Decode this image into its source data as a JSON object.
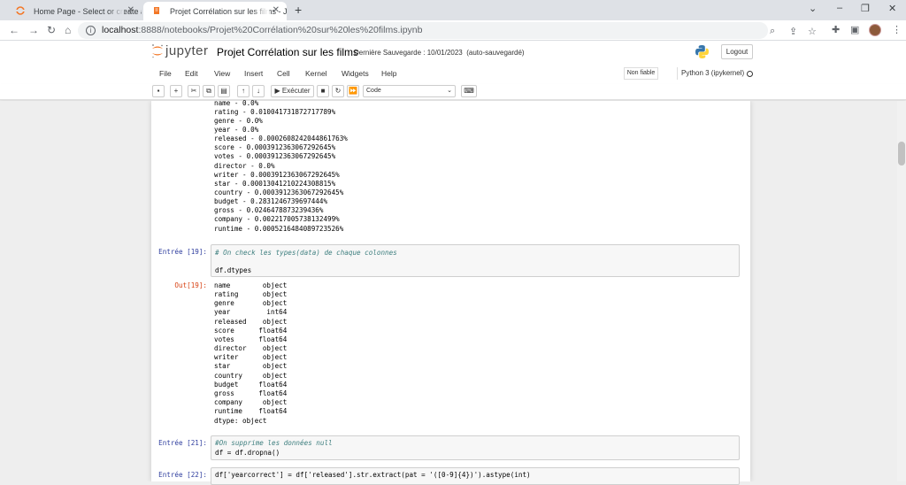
{
  "browser": {
    "tabs": [
      {
        "title": "Home Page - Select or create a n",
        "active": false
      },
      {
        "title": "Projet Corrélation sur les films - J",
        "active": true
      }
    ],
    "new_tab_label": "+",
    "url_host": "localhost",
    "url_rest": ":8888/notebooks/Projet%20Corrélation%20sur%20les%20films.ipynb",
    "icons": [
      "back-icon",
      "forward-icon",
      "reload-icon",
      "home-icon",
      "info-icon",
      "zoom-icon",
      "share-icon",
      "bookmark-star-icon",
      "extensions-icon",
      "sidepanel-icon",
      "profile-avatar",
      "menu-kebab-icon"
    ]
  },
  "jupyter": {
    "logo_text": "jupyter",
    "notebook_name": "Projet Corrélation sur les films",
    "checkpoint": "Dernière Sauvegarde : 10/01/2023",
    "autosave": "(auto-sauvegardé)",
    "logout": "Logout",
    "menu": [
      "File",
      "Edit",
      "View",
      "Insert",
      "Cell",
      "Kernel",
      "Widgets",
      "Help"
    ],
    "trust": "Non fiable",
    "kernel": "Python 3 (ipykernel)",
    "toolbar": {
      "run_label": "Exécuter",
      "cell_type": "Code"
    }
  },
  "cells": {
    "missing_output": [
      "name - 0.0%",
      "rating - 0.010041731872717789%",
      "genre - 0.0%",
      "year - 0.0%",
      "released - 0.0002608242044861763%",
      "score - 0.0003912363067292645%",
      "votes - 0.0003912363067292645%",
      "director - 0.0%",
      "writer - 0.0003912363067292645%",
      "star - 0.00013041210224308815%",
      "country - 0.0003912363067292645%",
      "budget - 0.2831246739697444%",
      "gross - 0.0246478873239436%",
      "company - 0.002217005738132499%",
      "runtime - 0.0005216484089723526%"
    ],
    "cell19": {
      "in_prompt": "Entrée [19]:",
      "comment": "# On check les types(data) de chaque colonnes",
      "code": "df.dtypes",
      "out_prompt": "Out[19]:",
      "output": [
        "name        object",
        "rating      object",
        "genre       object",
        "year         int64",
        "released    object",
        "score      float64",
        "votes      float64",
        "director    object",
        "writer      object",
        "star        object",
        "country     object",
        "budget     float64",
        "gross      float64",
        "company     object",
        "runtime    float64",
        "dtype: object"
      ]
    },
    "cell21": {
      "in_prompt": "Entrée [21]:",
      "comment": "#On supprime les données null",
      "code": "df = df.dropna()"
    },
    "cell22": {
      "in_prompt": "Entrée [22]:",
      "code": "df['yearcorrect'] = df['released'].str.extract(pat = '([0-9]{4})').astype(int)"
    }
  }
}
